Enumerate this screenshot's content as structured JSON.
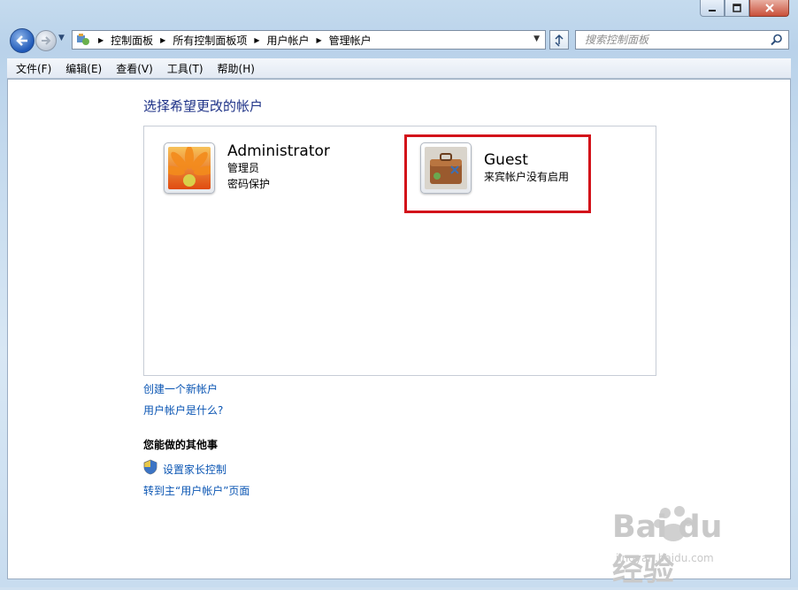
{
  "window": {
    "caption_buttons": [
      "minimize",
      "maximize",
      "close"
    ]
  },
  "address_bar": {
    "breadcrumb": [
      "控制面板",
      "所有控制面板项",
      "用户帐户",
      "管理帐户"
    ]
  },
  "search": {
    "placeholder": "搜索控制面板"
  },
  "menu": {
    "items": [
      "文件(F)",
      "编辑(E)",
      "查看(V)",
      "工具(T)",
      "帮助(H)"
    ]
  },
  "main": {
    "heading": "选择希望更改的帐户",
    "accounts": [
      {
        "name": "Administrator",
        "lines": [
          "管理员",
          "密码保护"
        ],
        "icon": "flower-avatar-icon"
      },
      {
        "name": "Guest",
        "lines": [
          "来宾帐户没有启用"
        ],
        "icon": "suitcase-avatar-icon"
      }
    ],
    "links": {
      "create_account": "创建一个新帐户",
      "what_is": "用户帐户是什么?"
    },
    "other_tasks": {
      "heading": "您能做的其他事",
      "parental_control": "设置家长控制",
      "goto_main": "转到主“用户帐户”页面"
    }
  },
  "watermark": {
    "brand": "Bai du 经验",
    "url": "jingyan.baidu.com"
  },
  "colors": {
    "link": "#0a55b3",
    "heading": "#1e3287",
    "highlight_box": "#d3121a"
  }
}
